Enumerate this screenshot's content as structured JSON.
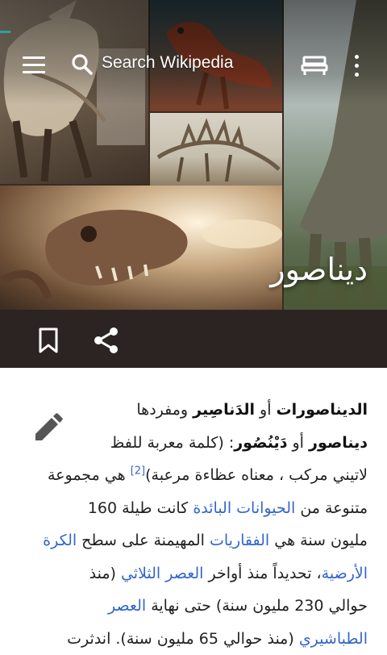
{
  "toolbar": {
    "search_placeholder": "Search Wikipedia"
  },
  "page": {
    "title": "ديناصور"
  },
  "article": {
    "lines": [
      [
        {
          "t": "الديناصورات",
          "b": true
        },
        {
          "t": " أو "
        },
        {
          "t": "الدَناصِير",
          "b": true
        },
        {
          "t": " ومفردها"
        }
      ],
      [
        {
          "t": "ديناصور",
          "b": true
        },
        {
          "t": " أو "
        },
        {
          "t": "دَيْنُصُور",
          "b": true
        },
        {
          "t": ": (كلمة معربة للفظ"
        }
      ],
      [
        {
          "t": "لاتيني مركب ، معناه عظاءة مرعبة)"
        },
        {
          "t": "[2]",
          "ref": true
        },
        {
          "t": " هي مجموعة"
        }
      ],
      [
        {
          "t": "متنوعة من "
        },
        {
          "t": "الحيوانات البائدة",
          "link": true
        },
        {
          "t": " كانت طيلة 160"
        }
      ],
      [
        {
          "t": "مليون سنة هي "
        },
        {
          "t": "الفقاريات",
          "link": true
        },
        {
          "t": " المهيمنة على سطح "
        },
        {
          "t": "الكرة",
          "link": true
        }
      ],
      [
        {
          "t": "الأرضية",
          "link": true
        },
        {
          "t": "، تحديداً منذ أواخر "
        },
        {
          "t": "العصر الثلاثي",
          "link": true
        },
        {
          "t": " (منذ"
        }
      ],
      [
        {
          "t": "حوالي 230 مليون سنة) حتى نهاية "
        },
        {
          "t": "العصر",
          "link": true
        }
      ],
      [
        {
          "t": "الطباشيري",
          "link": true
        },
        {
          "t": " (منذ حوالي 65 مليون سنة). اندثرت"
        }
      ]
    ]
  },
  "colors": {
    "link": "#3366cc",
    "action_bar": "#2c2323",
    "progress": "#26a69a"
  },
  "icons": [
    "menu-icon",
    "search-icon",
    "reading-lists-icon",
    "overflow-menu-icon",
    "bookmark-icon",
    "share-icon",
    "edit-pencil-icon"
  ]
}
